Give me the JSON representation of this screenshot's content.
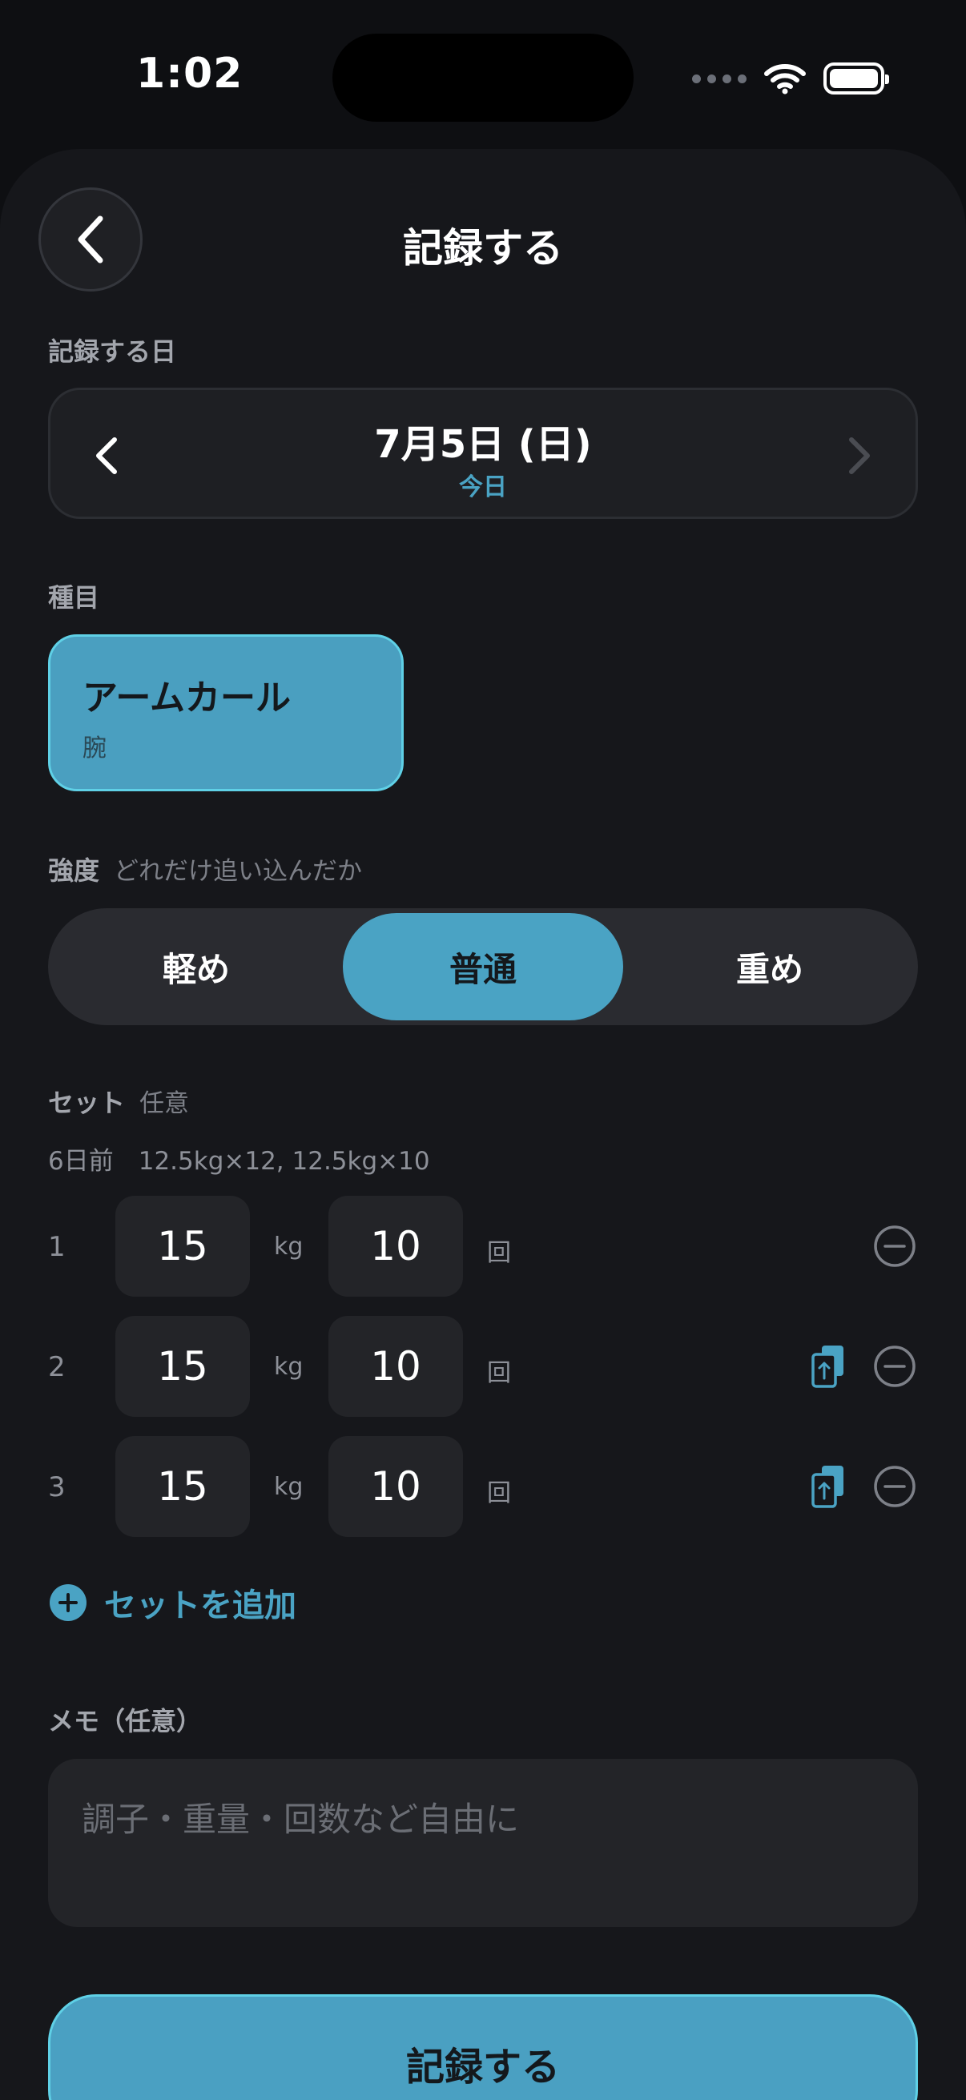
{
  "status_bar": {
    "time": "1:02"
  },
  "header": {
    "title": "記録する",
    "back_icon": "chevron-left-icon"
  },
  "date_section": {
    "label": "記録する日",
    "date": "7月5日 (日)",
    "relative": "今日"
  },
  "exercise_section": {
    "label": "種目",
    "exercise": {
      "name": "アームカール",
      "body_part": "腕"
    }
  },
  "intensity_section": {
    "label": "強度",
    "hint": "どれだけ追い込んだか",
    "options": [
      "軽め",
      "普通",
      "重め"
    ],
    "selected": "普通"
  },
  "sets_section": {
    "label": "セット",
    "optional": "任意",
    "previous_record": "6日前　12.5kg×12, 12.5kg×10",
    "weight_unit": "kg",
    "reps_unit": "回",
    "sets": [
      {
        "number": "1",
        "weight": "15",
        "reps": "10",
        "copy": false
      },
      {
        "number": "2",
        "weight": "15",
        "reps": "10",
        "copy": true
      },
      {
        "number": "3",
        "weight": "15",
        "reps": "10",
        "copy": true
      }
    ],
    "add_label": "セットを追加"
  },
  "memo_section": {
    "label": "メモ（任意）",
    "placeholder": "調子・重量・回数など自由に",
    "value": ""
  },
  "submit": {
    "label": "記録する"
  },
  "colors": {
    "accent": "#4aa3c4",
    "accent_border": "#5fd0e6",
    "background": "#0e0f12",
    "sheet": "#16171b"
  }
}
